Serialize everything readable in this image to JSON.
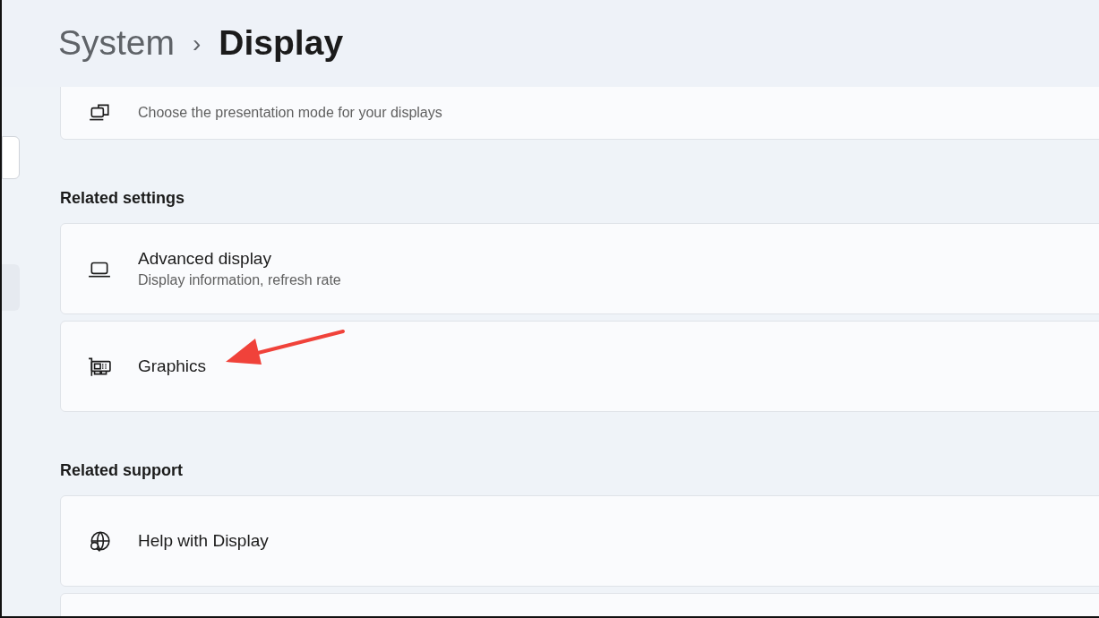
{
  "breadcrumb": {
    "parent": "System",
    "separator": "›",
    "current": "Display"
  },
  "sections": [
    {
      "items": [
        {
          "kind": "monitors",
          "subtitle": "Choose the presentation mode for your displays"
        }
      ]
    },
    {
      "heading": "Related settings",
      "items": [
        {
          "kind": "laptop",
          "title": "Advanced display",
          "subtitle": "Display information, refresh rate"
        },
        {
          "kind": "gpu",
          "title": "Graphics"
        }
      ]
    },
    {
      "heading": "Related support",
      "items": [
        {
          "kind": "globe",
          "title": "Help with Display"
        },
        {
          "kind": "blank"
        }
      ]
    }
  ]
}
